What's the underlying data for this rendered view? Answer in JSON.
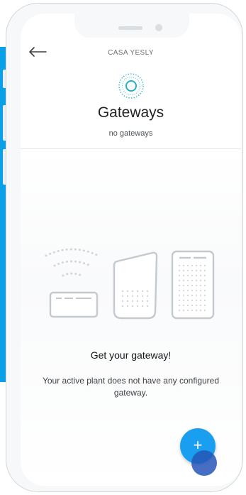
{
  "header": {
    "plant_name": "CASA YESLY",
    "title": "Gateways",
    "subtitle": "no gateways"
  },
  "empty_state": {
    "title": "Get your gateway!",
    "message": "Your active plant does not have any configured gateway."
  },
  "fab": {
    "label": "+"
  },
  "icons": {
    "back": "arrow-left-icon",
    "status": "gateway-signal-icon",
    "illustration": "gateway-devices-illustration"
  },
  "colors": {
    "accent": "#1a9ff0",
    "side_band": "#0aa0e8",
    "status_ring": "#2ab8c9",
    "touch_indicator": "#2656b8"
  }
}
